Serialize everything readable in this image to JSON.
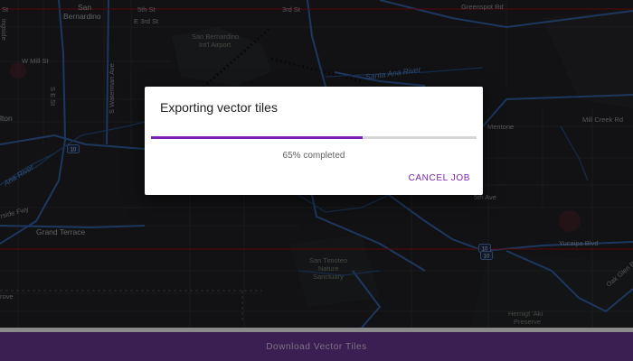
{
  "map": {
    "labels": {
      "st": "St",
      "san_bernardino_1": "San",
      "san_bernardino_2": "Bernardino",
      "e5th": "5th St",
      "e3rd": "E 3rd St",
      "third_st": "3rd St",
      "greenspot": "Greenspot Rd",
      "w_mill": "W Mill St",
      "airport_1": "San Bernardino",
      "airport_2": "Int'l Airport",
      "santa_ana": "Santa Ana River",
      "s_e_st": "S E St",
      "s_waterman": "S Waterman Ave",
      "alton": "lton",
      "mentone": "Mentone",
      "mill_creek": "Mill Creek Rd",
      "ana_river_left": "Ana River",
      "side_fwy": "rside Fwy",
      "ave_5th": "5th Ave",
      "grand_terrace": "Grand Terrace",
      "yucaipa": "Yucaipa Blvd",
      "oak_glen": "Oak Glen R",
      "sanctuary_1": "San Timoteo",
      "sanctuary_2": "Nature",
      "sanctuary_3": "Sanctuary",
      "hernight_1": "Hernigt 'Aki",
      "hernight_2": "Preserve",
      "grove": "rove",
      "ingside": "ingside"
    },
    "shields": [
      "10",
      "10",
      "10"
    ]
  },
  "dialog": {
    "title": "Exporting vector tiles",
    "progress_percent": 65,
    "progress_text": "65% completed",
    "cancel_label": "CANCEL JOB"
  },
  "bottom_bar": {
    "label": "Download Vector Tiles"
  },
  "colors": {
    "accent": "#7b22b5",
    "bottom_bar": "#3b1e52",
    "map_bg": "#1d1e21",
    "road": "#2f5a9a",
    "boundary": "#8a1010"
  }
}
